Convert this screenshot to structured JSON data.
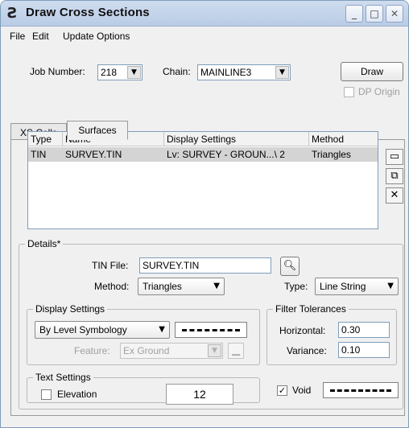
{
  "window": {
    "title": "Draw Cross Sections",
    "icon": "app-logo-icon"
  },
  "titlebar_buttons": {
    "minimize": "_",
    "maximize": "□",
    "close": "✕"
  },
  "menu": [
    "File",
    "Edit",
    "Update Options"
  ],
  "job": {
    "label": "Job Number:",
    "value": "218"
  },
  "chain": {
    "label": "Chain:",
    "value": "MAINLINE3"
  },
  "draw_button": "Draw",
  "dp_origin": {
    "label": "DP Origin",
    "checked": false
  },
  "tabs": [
    {
      "label": "XS Cells",
      "active": false
    },
    {
      "label": "Surfaces",
      "active": true
    }
  ],
  "surfaces_table": {
    "columns": [
      "Type",
      "Name",
      "Display Settings",
      "Method"
    ],
    "rows": [
      [
        "TIN",
        "SURVEY.TIN",
        "Lv: SURVEY - GROUN...\\ 2",
        "Triangles"
      ]
    ]
  },
  "side_buttons": [
    "add-icon",
    "copy-icon",
    "delete-icon"
  ],
  "details": {
    "legend": "Details*",
    "tin_label": "TIN File:",
    "tin_value": "SURVEY.TIN",
    "method_label": "Method:",
    "method_value": "Triangles",
    "type_label": "Type:",
    "type_value": "Line String"
  },
  "display_settings": {
    "legend": "Display Settings",
    "symbology_value": "By Level Symbology",
    "feature_label": "Feature:",
    "feature_value": "Ex Ground"
  },
  "filter": {
    "legend": "Filter Tolerances",
    "horizontal_label": "Horizontal:",
    "horizontal_value": "0.30",
    "variance_label": "Variance:",
    "variance_value": "0.10"
  },
  "text_settings": {
    "legend": "Text Settings",
    "elevation_label": "Elevation",
    "elevation_checked": false,
    "sample_text": "12"
  },
  "void": {
    "label": "Void",
    "checked": true
  }
}
